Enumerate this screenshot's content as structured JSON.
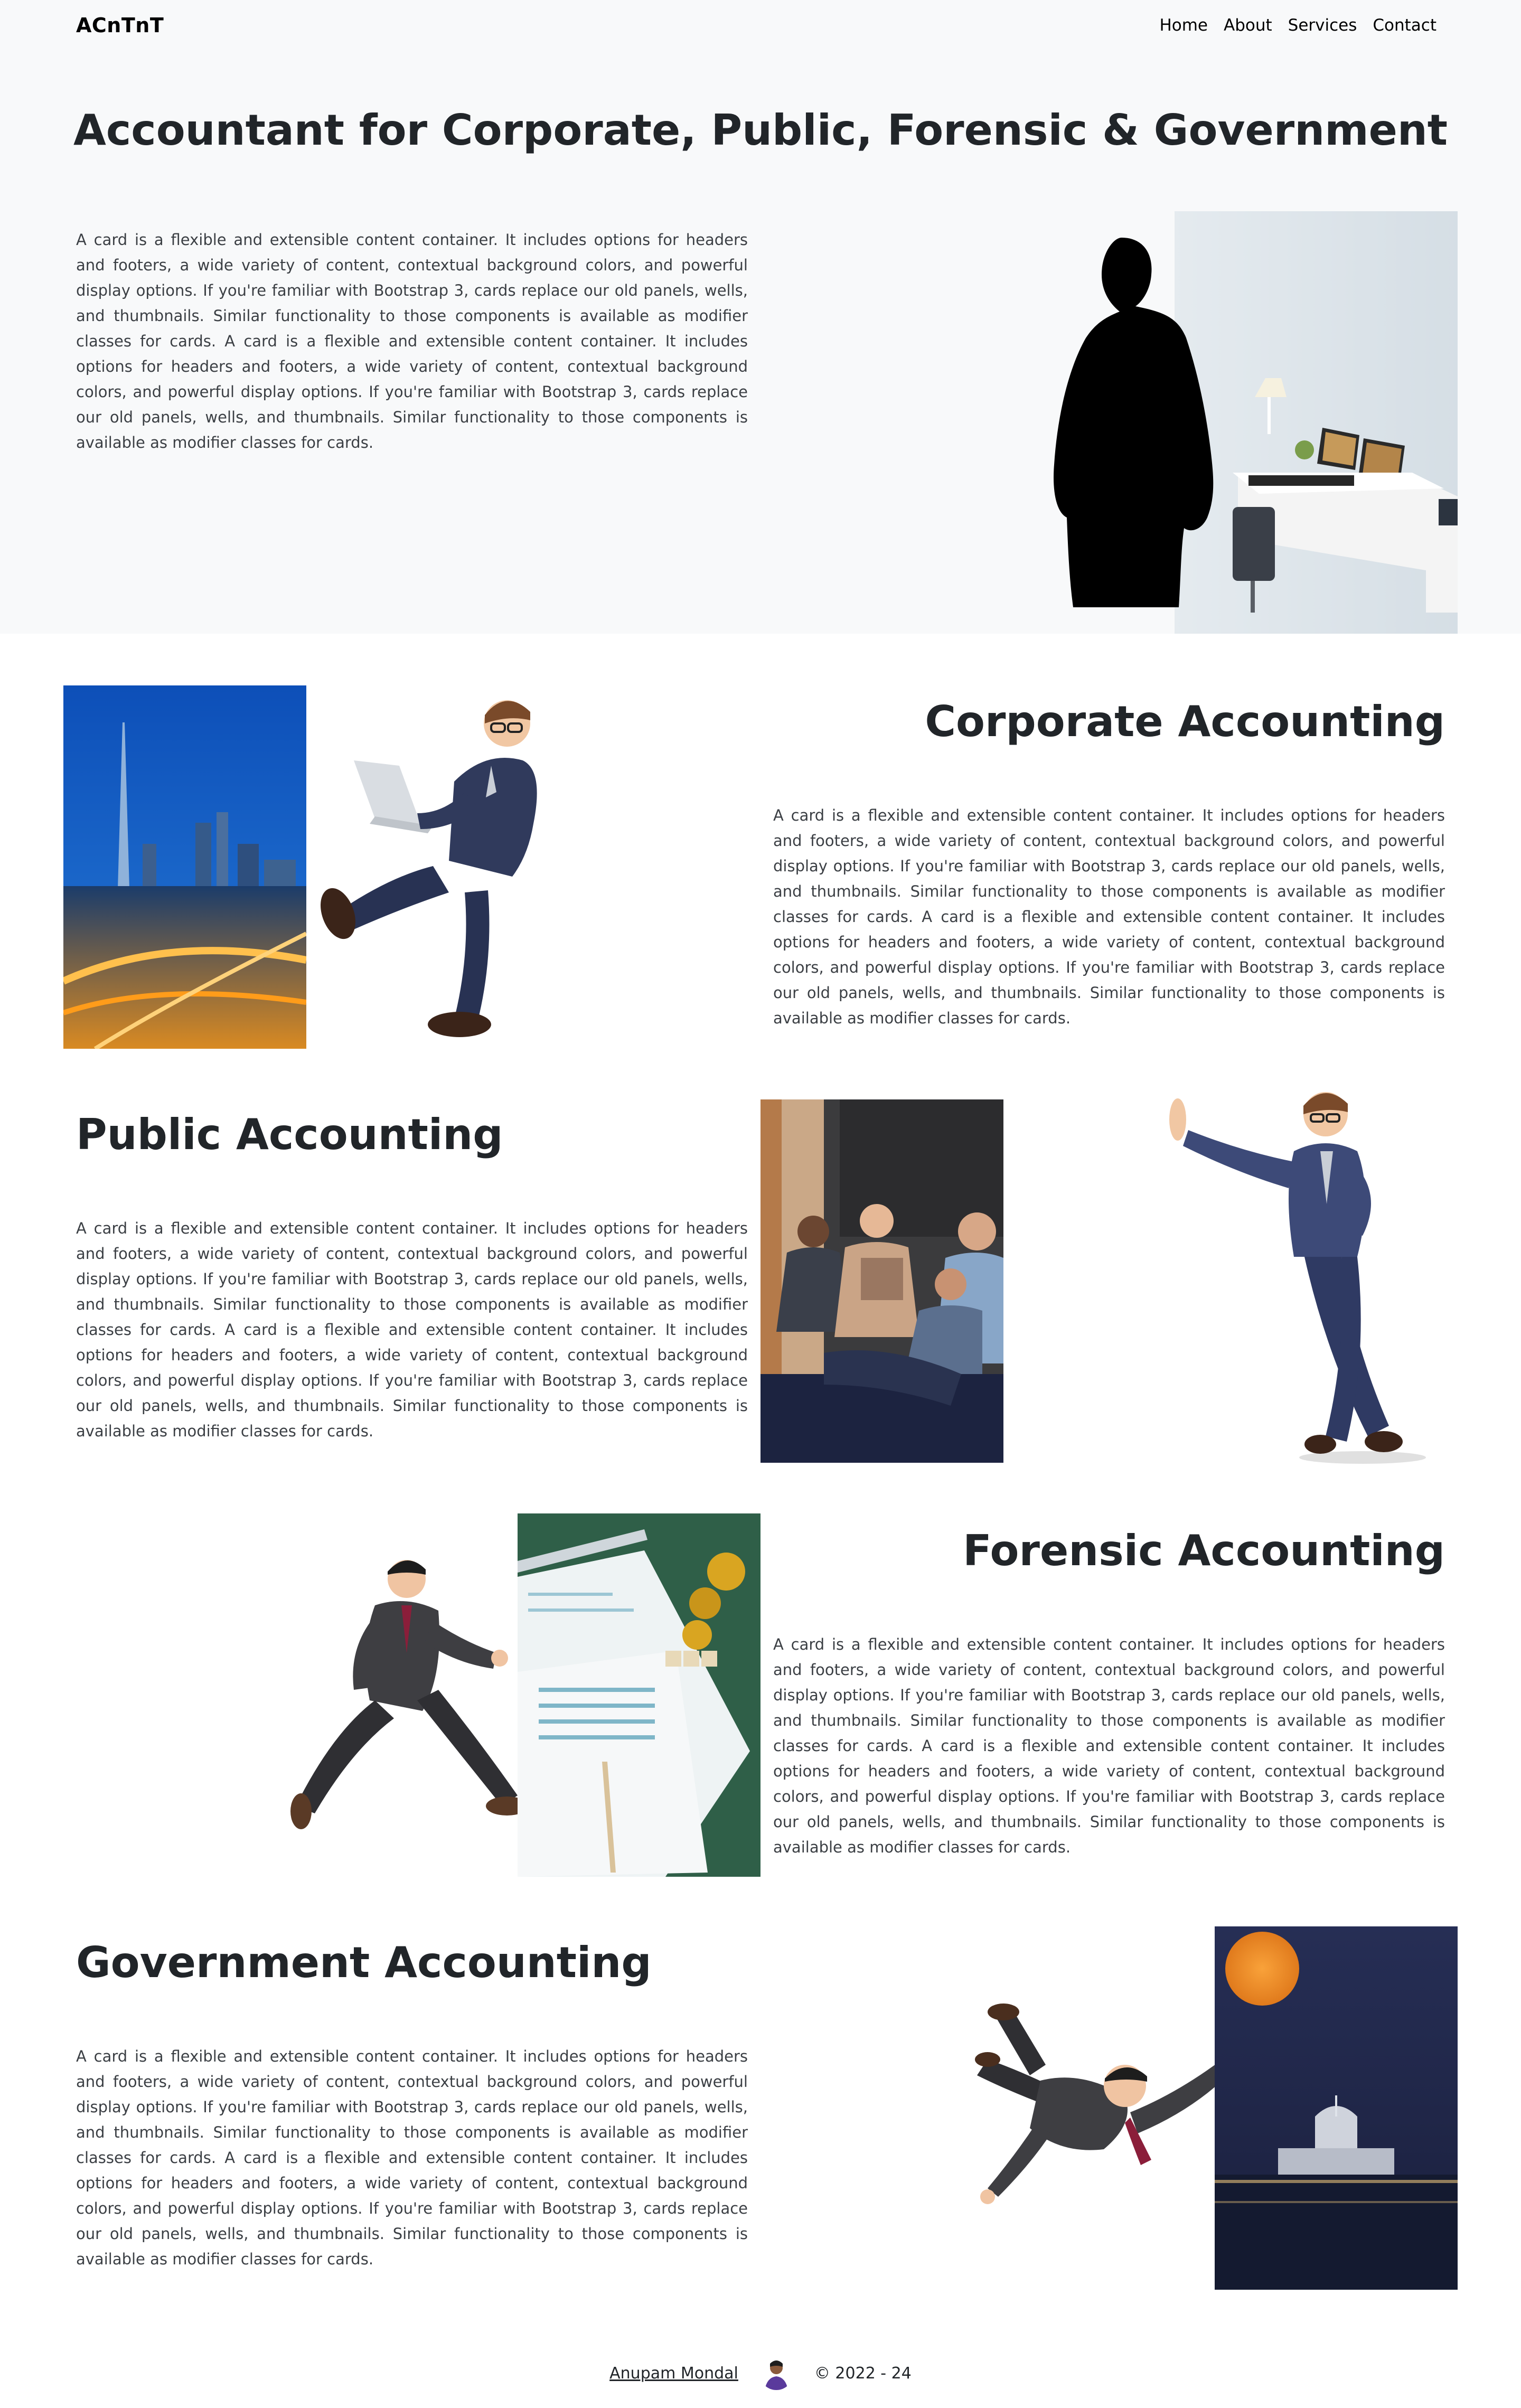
{
  "nav": {
    "brand": "ACnTnT",
    "links": [
      "Home",
      "About",
      "Services",
      "Contact"
    ]
  },
  "hero": {
    "title": "Accountant for Corporate, Public, Forensic & Government",
    "text": "A card is a flexible and extensible content container. It includes options for headers and footers, a wide variety of content, contextual background colors, and powerful display options. If you're familiar with Bootstrap 3, cards replace our old panels, wells, and thumbnails. Similar functionality to those components is available as modifier classes for cards. A card is a flexible and extensible content container. It includes options for headers and footers, a wide variety of content, contextual background colors, and powerful display options. If you're familiar with Bootstrap 3, cards replace our old panels, wells, and thumbnails. Similar functionality to those components is available as modifier classes for cards."
  },
  "sections": [
    {
      "title": "Corporate Accounting",
      "text": "A card is a flexible and extensible content container. It includes options for headers and footers, a wide variety of content, contextual background colors, and powerful display options. If you're familiar with Bootstrap 3, cards replace our old panels, wells, and thumbnails. Similar functionality to those components is available as modifier classes for cards. A card is a flexible and extensible content container. It includes options for headers and footers, a wide variety of content, contextual background colors, and powerful display options. If you're familiar with Bootstrap 3, cards replace our old panels, wells, and thumbnails. Similar functionality to those components is available as modifier classes for cards."
    },
    {
      "title": "Public Accounting",
      "text": "A card is a flexible and extensible content container. It includes options for headers and footers, a wide variety of content, contextual background colors, and powerful display options. If you're familiar with Bootstrap 3, cards replace our old panels, wells, and thumbnails. Similar functionality to those components is available as modifier classes for cards. A card is a flexible and extensible content container. It includes options for headers and footers, a wide variety of content, contextual background colors, and powerful display options. If you're familiar with Bootstrap 3, cards replace our old panels, wells, and thumbnails. Similar functionality to those components is available as modifier classes for cards."
    },
    {
      "title": "Forensic Accounting",
      "text": "A card is a flexible and extensible content container. It includes options for headers and footers, a wide variety of content, contextual background colors, and powerful display options. If you're familiar with Bootstrap 3, cards replace our old panels, wells, and thumbnails. Similar functionality to those components is available as modifier classes for cards. A card is a flexible and extensible content container. It includes options for headers and footers, a wide variety of content, contextual background colors, and powerful display options. If you're familiar with Bootstrap 3, cards replace our old panels, wells, and thumbnails. Similar functionality to those components is available as modifier classes for cards."
    },
    {
      "title": "Government Accounting",
      "text": "A card is a flexible and extensible content container. It includes options for headers and footers, a wide variety of content, contextual background colors, and powerful display options. If you're familiar with Bootstrap 3, cards replace our old panels, wells, and thumbnails. Similar functionality to those components is available as modifier classes for cards. A card is a flexible and extensible content container. It includes options for headers and footers, a wide variety of content, contextual background colors, and powerful display options. If you're familiar with Bootstrap 3, cards replace our old panels, wells, and thumbnails. Similar functionality to those components is available as modifier classes for cards."
    }
  ],
  "footer": {
    "author": "Anupam Mondal",
    "copyright": "© 2022 - 24"
  },
  "colors": {
    "hero_background": "#f8f9fa",
    "heading": "#212529",
    "body_text": "#3b3f44"
  },
  "images": {
    "hero": "silhouette-of-person-beside-office-desk-photo",
    "corporate": [
      "city-skyline-at-night-photo",
      "businessman-with-laptop-3d-figure"
    ],
    "public": [
      "people-seated-in-meeting-photo",
      "leaning-businessman-3d-figure"
    ],
    "forensic": [
      "running-businessman-3d-figure",
      "tax-forms-and-coins-photo"
    ],
    "government": [
      "flying-businessman-3d-figure",
      "capitol-building-under-moon-photo"
    ],
    "footer": "author-avatar"
  }
}
